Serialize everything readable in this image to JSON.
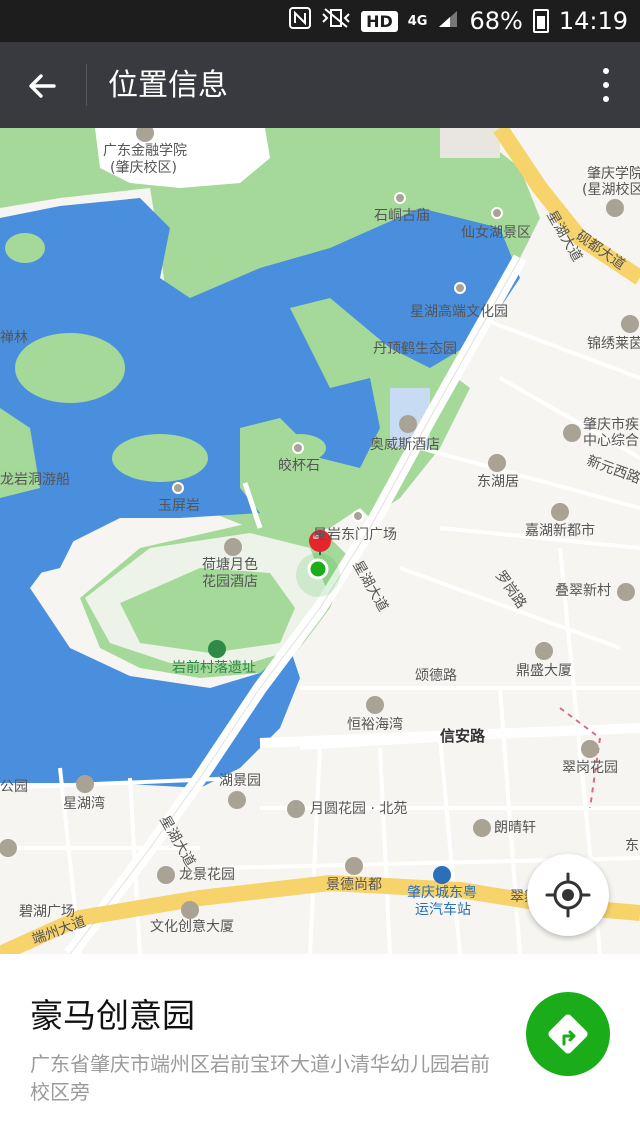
{
  "status_bar": {
    "hd": "HD",
    "net": "4G",
    "battery": "68%",
    "time": "14:19"
  },
  "header": {
    "title": "位置信息"
  },
  "map": {
    "colors": {
      "water": "#4a8fde",
      "park": "#a5d99a",
      "land": "#f6f5f1",
      "highway": "#f7d36b",
      "marker_red": "#e4252b",
      "marker_green": "#1aad19"
    },
    "road_labels": {
      "xinghu_1": "星湖大道",
      "xinghu_2": "星湖大道",
      "xinghu_3": "星湖大道",
      "yandu": "砚都大道",
      "duanzhou": "端州大道",
      "xinan": "信安路",
      "songde": "颂德路",
      "xinyuan": "新元西路",
      "luogang": "罗岗路"
    },
    "labels": {
      "gdjr": "广东金融学院",
      "gdjr_sub": "(肇庆校区)",
      "zqxy": "肇庆学院",
      "zqxy_sub": "(星湖校区)",
      "shigu": "石峒古庙",
      "xiannv": "仙女湖景区",
      "xhgd": "星湖高端文化园",
      "dingding": "丹顶鹤生态园",
      "jinxiu": "锦绣莱茵",
      "chanlin": "禅林",
      "aowei": "奥威斯酒店",
      "zqsj": "肇庆市疾",
      "zqsj_sub": "中心综合",
      "longyan": "龙岩洞游船",
      "jiaobei": "皎杯石",
      "dongcheng": "东湖居",
      "yuping": "玉屏岩",
      "jiahu": "嘉湖新都市",
      "dmgc": "星岩东门广场",
      "hetang": "荷塘月色",
      "hetang_sub": "花园酒店",
      "diecui": "叠翠新村",
      "yqc": "岩前村落遗址",
      "dingsheng": "鼎盛大厦",
      "hengyu": "恒裕海湾",
      "cuigang": "翠岗花园",
      "gongyuan": "公园",
      "hujing": "湖景园",
      "xinghuwan": "星湖湾",
      "yueyuan": "月圆花园 · 北苑",
      "langqing": "朗晴轩",
      "dong": "东",
      "longjing": "龙景花园",
      "jingde": "景德尚都",
      "zqcd": "肇庆城东粤",
      "zqcd_sub": "运汽车站",
      "cui": "翠舞",
      "bihu": "碧湖广场",
      "wenhua": "文化创意大厦"
    }
  },
  "place": {
    "name": "豪马创意园",
    "address": "广东省肇庆市端州区岩前宝环大道小清华幼儿园岩前校区旁"
  },
  "icons": {
    "back": "back-arrow-icon",
    "more": "more-vertical-icon",
    "locate": "locate-icon",
    "navigate": "navigate-icon"
  }
}
